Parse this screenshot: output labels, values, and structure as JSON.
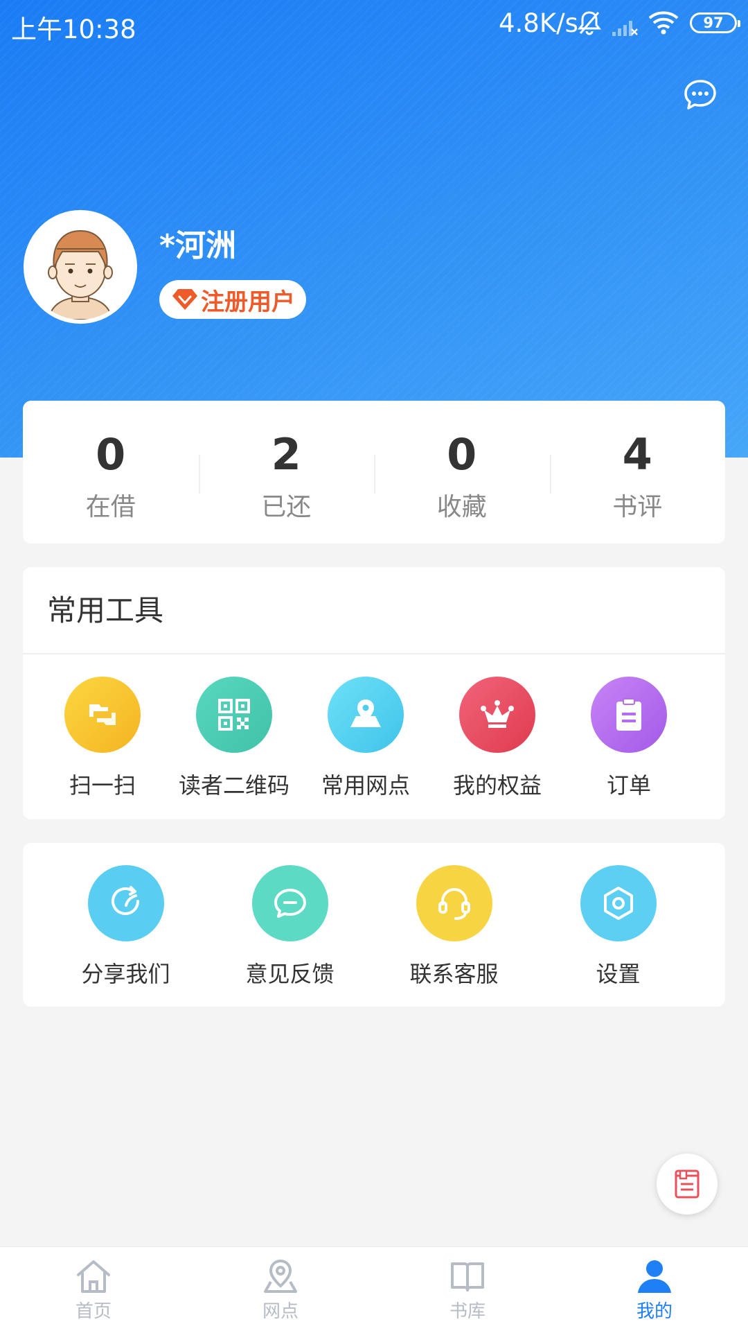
{
  "status_bar": {
    "time": "上午10:38",
    "speed": "4.8K/s",
    "battery": "97",
    "icons": [
      "bell-off-icon",
      "signal-icon",
      "wifi-icon",
      "battery-icon"
    ]
  },
  "header": {
    "chat_icon": "chat-bubble-icon",
    "gradient_colors": [
      "#1a7cf5",
      "#46a6f8"
    ]
  },
  "profile": {
    "name": "*河洲",
    "badge": "注册用户",
    "badge_color": "#ef5a2a"
  },
  "stats": [
    {
      "value": "0",
      "label": "在借"
    },
    {
      "value": "2",
      "label": "已还"
    },
    {
      "value": "0",
      "label": "收藏"
    },
    {
      "value": "4",
      "label": "书评"
    }
  ],
  "tools": {
    "title": "常用工具",
    "items": [
      {
        "label": "扫一扫",
        "icon": "scan-icon",
        "color": "#f7c231"
      },
      {
        "label": "读者二维码",
        "icon": "qr-code-icon",
        "color": "#4dcdb3"
      },
      {
        "label": "常用网点",
        "icon": "map-pin-icon",
        "color": "#55d3f0"
      },
      {
        "label": "我的权益",
        "icon": "crown-icon",
        "color": "#e94a5e"
      },
      {
        "label": "订单",
        "icon": "clipboard-icon",
        "color": "#b56cf0"
      }
    ]
  },
  "more": {
    "items": [
      {
        "label": "分享我们",
        "icon": "share-icon",
        "color": "#5acdf3"
      },
      {
        "label": "意见反馈",
        "icon": "feedback-icon",
        "color": "#5cdac4"
      },
      {
        "label": "联系客服",
        "icon": "headset-icon",
        "color": "#f6d442"
      },
      {
        "label": "设置",
        "icon": "settings-icon",
        "color": "#5ccff3"
      }
    ]
  },
  "floating_button": {
    "icon": "document-icon"
  },
  "bottom_nav": {
    "items": [
      {
        "label": "首页",
        "icon": "home-icon"
      },
      {
        "label": "网点",
        "icon": "location-icon"
      },
      {
        "label": "书库",
        "icon": "book-icon"
      },
      {
        "label": "我的",
        "icon": "user-icon",
        "active": true
      }
    ],
    "active_color": "#1f7ff5",
    "inactive_color": "#b6bcc6"
  }
}
